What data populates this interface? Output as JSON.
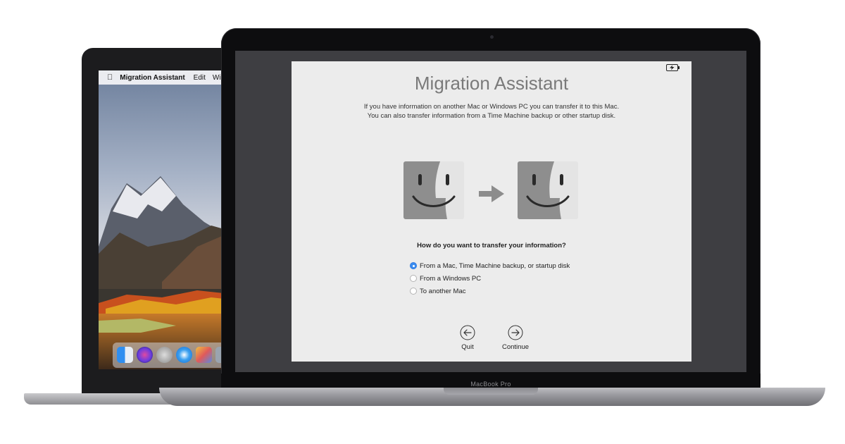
{
  "back_mac": {
    "menubar": {
      "apple": "",
      "app_name": "Migration Assistant",
      "items": [
        "Edit",
        "Wi"
      ]
    },
    "dock_icons": [
      "finder-icon",
      "siri-icon",
      "launchpad-icon",
      "safari-icon",
      "photos-icon"
    ]
  },
  "front_mac": {
    "model_label": "MacBook Pro"
  },
  "window": {
    "title": "Migration Assistant",
    "intro_line1": "If you have information on another Mac or Windows PC you can transfer it to this Mac.",
    "intro_line2": "You can also transfer information from a Time Machine backup or other startup disk.",
    "question": "How do you want to transfer your information?",
    "options": [
      {
        "label": "From a Mac, Time Machine backup, or startup disk",
        "selected": true
      },
      {
        "label": "From a Windows PC",
        "selected": false
      },
      {
        "label": "To another Mac",
        "selected": false
      }
    ],
    "quit_label": "Quit",
    "continue_label": "Continue"
  },
  "colors": {
    "accent": "#3b8cf0",
    "window_bg": "#ececec",
    "title_gray": "#7a7a7a"
  }
}
